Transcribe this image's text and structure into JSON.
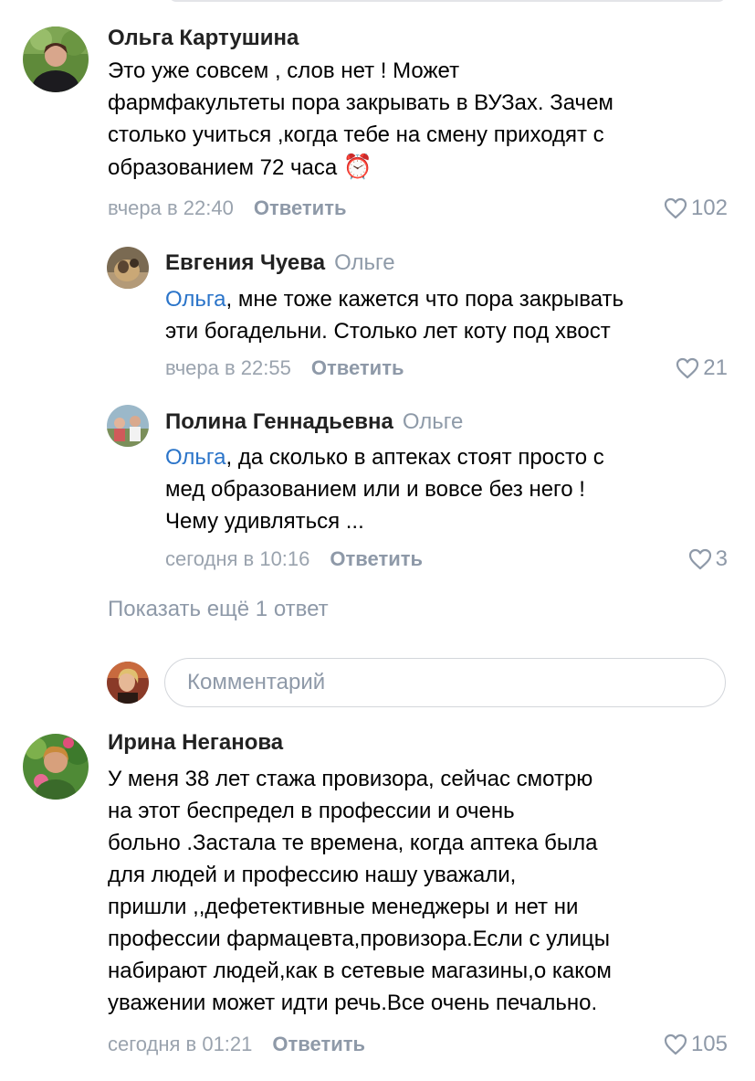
{
  "comments": [
    {
      "author": "Ольга Картушина",
      "text": "Это уже совсем , слов нет ! Может\nфармфакультеты пора закрывать в ВУЗах. Зачем\nстолько учиться ,когда тебе на смену приходят с\nобразованием 72 часа",
      "emoji": "⏰",
      "time": "вчера в 22:40",
      "reply_label": "Ответить",
      "likes": "102"
    },
    {
      "author": "Евгения Чуева",
      "reply_to": "Ольге",
      "mention": "Ольга",
      "text": ", мне тоже кажется что пора закрывать\nэти богадельни. Столько лет коту под хвост",
      "time": "вчера в 22:55",
      "reply_label": "Ответить",
      "likes": "21"
    },
    {
      "author": "Полина Геннадьевна",
      "reply_to": "Ольге",
      "mention": "Ольга",
      "text": ", да сколько в аптеках стоят просто с\nмед образованием или и вовсе без него !\nЧему удивляться ...",
      "time": "сегодня в 10:16",
      "reply_label": "Ответить",
      "likes": "3"
    },
    {
      "author": "Ирина Неганова",
      "text": "У меня 38 лет стажа провизора, сейчас смотрю\nна этот беспредел в профессии и очень\nбольно .Застала те времена, когда аптека была\nдля людей и профессию нашу уважали,\nпришли ,,дефетективные менеджеры и нет ни\nпрофессии фармацевта,провизора.Если с улицы\nнабирают людей,как в сетевые магазины,о каком\nуважении может идти речь.Все очень печально.",
      "time": "сегодня в 01:21",
      "reply_label": "Ответить",
      "likes": "105"
    }
  ],
  "show_more": "Показать ещё 1 ответ",
  "comment_input": {
    "placeholder": "Комментарий",
    "value": ""
  },
  "colors": {
    "accent": "#2a74c9",
    "secondary": "#8e99a8"
  },
  "icons": [
    "heart-icon",
    "alarm-clock-emoji"
  ]
}
